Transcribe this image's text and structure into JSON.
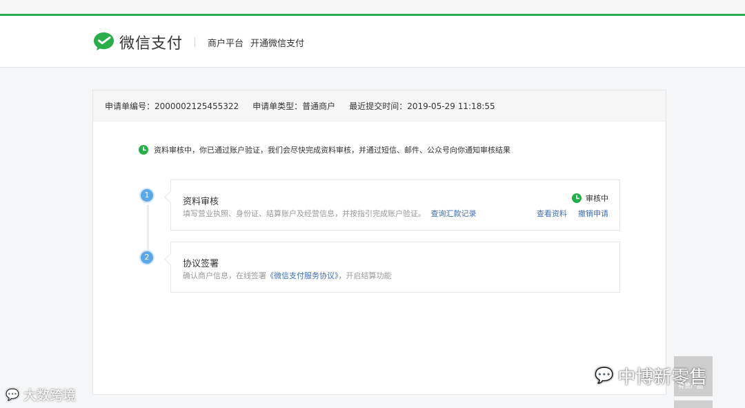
{
  "header": {
    "brand": "微信支付",
    "nav": [
      "商户平台",
      "开通微信支付"
    ]
  },
  "application": {
    "id_label": "申请单编号：2000002125455322",
    "type_label": "申请单类型：普通商户",
    "time_label": "最近提交时间：2019-05-29 11:18:55"
  },
  "notice": {
    "text": "资料审核中，你已通过账户验证，我们会尽快完成资料审核，并通过短信、邮件、公众号向你通知审核结果"
  },
  "steps": [
    {
      "number": "1",
      "title": "资料审核",
      "desc": "填写营业执照、身份证、结算账户及经营信息，并按指引完成账户验证。",
      "link": "查询汇款记录",
      "status": "审核中",
      "actions": [
        "查看资料",
        "撤销申请"
      ]
    },
    {
      "number": "2",
      "title": "协议签署",
      "desc_prefix": "确认商户信息，在线签署",
      "link": "《微信支付服务协议》",
      "desc_suffix": "，开启结算功能"
    }
  ],
  "watermarks": {
    "left": "大数跨境",
    "right": "中博新零售",
    "right_caption": "有赞产品"
  },
  "colors": {
    "brand_green": "#27ae4b",
    "link_blue": "#3f6db3",
    "step_blue": "#5ca7e6"
  }
}
